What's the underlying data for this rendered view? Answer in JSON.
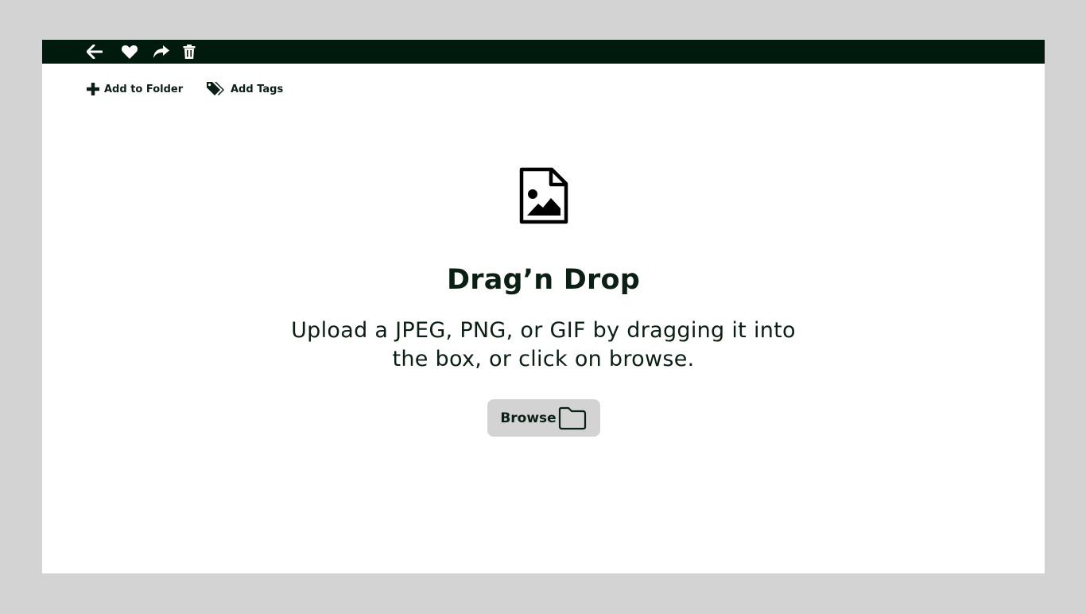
{
  "toolbar": {
    "icons": [
      "back-arrow-icon",
      "heart-icon",
      "share-icon",
      "trash-icon"
    ]
  },
  "actions": {
    "add_to_folder": "Add to Folder",
    "add_tags": "Add Tags"
  },
  "drop_zone": {
    "title": "Drag’n Drop",
    "description": "Upload a JPEG, PNG, or GIF by dragging it into the box, or click on browse.",
    "browse_label": "Browse"
  },
  "colors": {
    "toolbar_bg": "#001a0e",
    "text": "#0b1f14",
    "page_bg": "#d3d3d3",
    "panel_bg": "#ffffff",
    "button_bg": "#d3d3d3"
  }
}
